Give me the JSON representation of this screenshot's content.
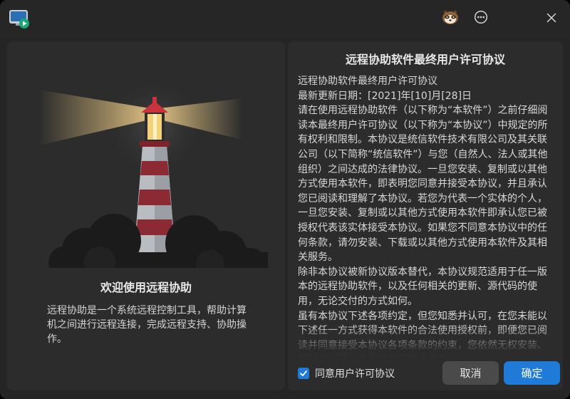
{
  "titlebar": {
    "app_icon": "remote-assist-monitor-icon",
    "avatar_icon": "raccoon-avatar-icon",
    "menu_icon": "more-options-icon",
    "close_icon": "close-icon"
  },
  "welcome": {
    "title": "欢迎使用远程协助",
    "description": "远程协助是一个系统远程控制工具，帮助计算机之间进行远程连接，完成远程支持、协助操作。"
  },
  "license": {
    "title": "远程协助软件最终用户许可协议",
    "paragraphs": [
      "远程协助软件最终用户许可协议",
      "最新更新日期：[2021]年[10]月[28]日",
      "请在使用远程协助软件（以下称为“本软件”）之前仔细阅读本最终用户许可协议（以下称为“本协议”）中规定的所有权利和限制。本协议是统信软件技术有限公司及其关联公司（以下简称“统信软件”）与您（自然人、法人或其他组织）之间达成的法律协议。一旦您安装、复制或以其他方式使用本软件，即表明您同意并接受本协议，并且承认您已阅读和理解了本协议。若您为代表一个实体的个人，一旦您安装、复制或以其他方式使用本软件即承认您已被授权代表该实体接受本协议。如果您不同意本协议中的任何条款，请勿安装、下载或以其他方式使用本软件及其相关服务。",
      "除非本协议被新协议版本替代，本协议规范适用于任一版本的远程协助软件，以及任何相关的更新、源代码的使用，无论交付的方式如何。",
      "虽有本协议下述各项约定，但您知悉并认可，在您未能以下述任一方式获得本软件的合法使用授权前，即便您已阅读并同意接受本协议各项条款的约束，您依然无权安装、复制或以其他任何方式使用本软件："
    ]
  },
  "agree": {
    "label": "同意用户许可协议",
    "checked": true
  },
  "buttons": {
    "cancel": "取消",
    "ok": "确定"
  },
  "colors": {
    "accent": "#1f7ad8",
    "panel": "#2c2c2c",
    "window": "#252525"
  }
}
